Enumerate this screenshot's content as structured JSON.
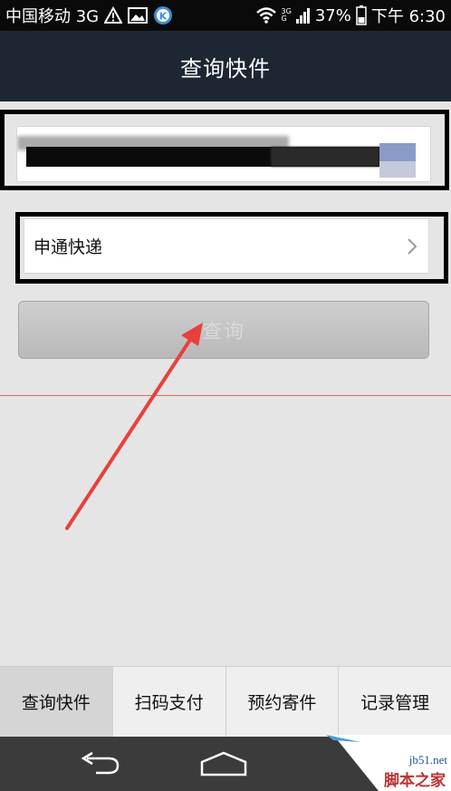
{
  "status_bar": {
    "carrier": "中国移动 3G",
    "network": "3G",
    "network_sub": "G",
    "battery": "37%",
    "time": "下午 6:30"
  },
  "header": {
    "title": "查询快件"
  },
  "form": {
    "tracking_number": "",
    "courier": "申通快递",
    "query_button": "查询"
  },
  "tabs": [
    {
      "label": "查询快件",
      "active": true
    },
    {
      "label": "扫码支付",
      "active": false
    },
    {
      "label": "预约寄件",
      "active": false
    },
    {
      "label": "记录管理",
      "active": false
    }
  ],
  "watermark": {
    "site": "jb51.net",
    "name": "脚本之家"
  },
  "colors": {
    "title_bar": "#1d2733",
    "background": "#e5e5e5",
    "arrow": "#e8403e",
    "tab_active": "#d5d5d5"
  },
  "icons": [
    "alert-icon",
    "image-icon",
    "k-app-icon",
    "wifi-icon",
    "signal-icon",
    "battery-icon",
    "chevron-right-icon",
    "back-icon",
    "home-icon"
  ]
}
